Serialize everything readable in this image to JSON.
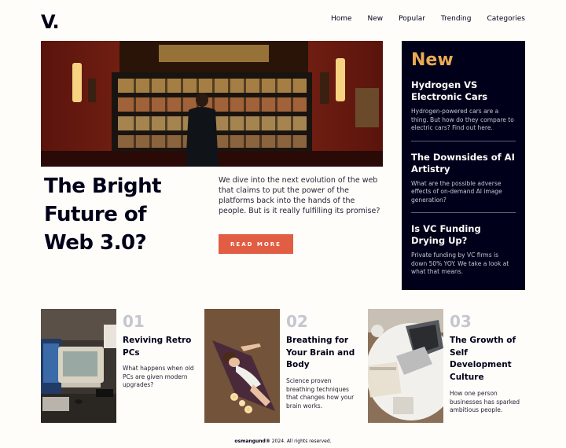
{
  "header": {
    "logo": "V.",
    "nav": [
      "Home",
      "New",
      "Popular",
      "Trending",
      "Categories"
    ]
  },
  "hero": {
    "title": "The Bright Future of Web 3.0?",
    "description": "We dive into the next evolution of the web that claims to put the power of the platforms back into the hands of the people. But is it really fulfilling its promise?",
    "button": "READ MORE"
  },
  "new_panel": {
    "heading": "New",
    "items": [
      {
        "title": "Hydrogen VS Electronic Cars",
        "desc": "Hydrogen-powered cars are a thing. But how do they compare to electric cars? Find out here."
      },
      {
        "title": "The Downsides of AI Artistry",
        "desc": "What are the possible adverse effects of on-demand AI image generation?"
      },
      {
        "title": "Is VC Funding Drying Up?",
        "desc": "Private funding by VC firms is down 50% YOY. We take a look at what that means."
      }
    ]
  },
  "cards": [
    {
      "num": "01",
      "title": "Reviving Retro PCs",
      "desc": "What happens when old PCs are given modern upgrades?"
    },
    {
      "num": "02",
      "title": "Breathing for Your Brain and Body",
      "desc": "Science proven breathing techniques that changes how your brain works."
    },
    {
      "num": "03",
      "title": "The Growth of Self Development Culture",
      "desc": "How one person businesses has sparked ambitious people."
    }
  ],
  "footer": {
    "brand": "osmangund®",
    "text": " 2024. All rights reserved."
  },
  "colors": {
    "dark": "#00001a",
    "accent": "#e15d44",
    "gold": "#e9ab53",
    "muted": "#c5c6d0",
    "bg": "#fffdf9"
  }
}
